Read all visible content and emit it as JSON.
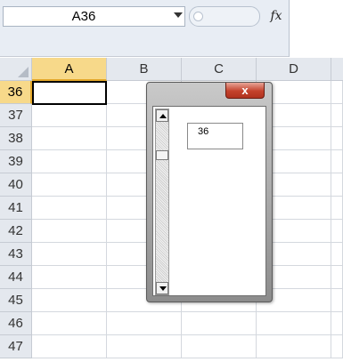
{
  "formula_bar": {
    "name_box": "A36",
    "fx_label": "fx",
    "formula": ""
  },
  "sheet": {
    "columns": [
      "A",
      "B",
      "C",
      "D"
    ],
    "selected_column": "A",
    "rows": [
      "36",
      "37",
      "38",
      "39",
      "40",
      "41",
      "42",
      "43",
      "44",
      "45",
      "46",
      "47"
    ],
    "selected_row": "36",
    "active_cell": "A36"
  },
  "dialog": {
    "close_label": "x",
    "value_box": "36",
    "scrollbar_value": 36
  }
}
